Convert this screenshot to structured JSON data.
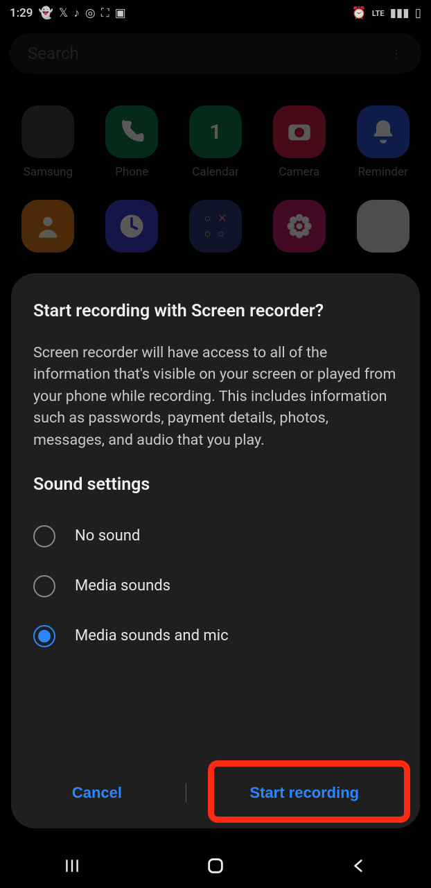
{
  "status": {
    "time": "1:29",
    "left_icons": [
      "snapchat-icon",
      "x-icon",
      "music-icon",
      "instagram-icon",
      "frame-icon",
      "image-icon"
    ],
    "right_icons": [
      "alarm-icon",
      "lte-icon",
      "signal-icon",
      "battery-icon"
    ],
    "network_label": "LTE"
  },
  "search": {
    "placeholder": "Search"
  },
  "apps": {
    "row1": [
      {
        "label": "Samsung",
        "type": "folder"
      },
      {
        "label": "Phone",
        "color": "#0f7a4a"
      },
      {
        "label": "Calendar",
        "color": "#0f7a4a",
        "text": "1"
      },
      {
        "label": "Camera",
        "color": "#cc1f3f"
      },
      {
        "label": "Reminder",
        "color": "#2b4fd1"
      }
    ],
    "row2": [
      {
        "label": "",
        "color": "#d97a1a"
      },
      {
        "label": "",
        "color": "#3a3fd1"
      },
      {
        "label": "",
        "color": "#2a3a7a"
      },
      {
        "label": "",
        "color": "#c21f6b"
      },
      {
        "label": "",
        "type": "folder"
      }
    ]
  },
  "dialog": {
    "title": "Start recording with Screen recorder?",
    "body": "Screen recorder will have access to all of the information that's visible on your screen or played from your phone while recording. This includes information such as passwords, payment details, photos, messages, and audio that you play.",
    "section_title": "Sound settings",
    "options": [
      {
        "label": "No sound",
        "selected": false
      },
      {
        "label": "Media sounds",
        "selected": false
      },
      {
        "label": "Media sounds and mic",
        "selected": true
      }
    ],
    "cancel_label": "Cancel",
    "confirm_label": "Start recording"
  },
  "highlight": {
    "target": "start-recording-button",
    "color": "#ff2a12"
  }
}
